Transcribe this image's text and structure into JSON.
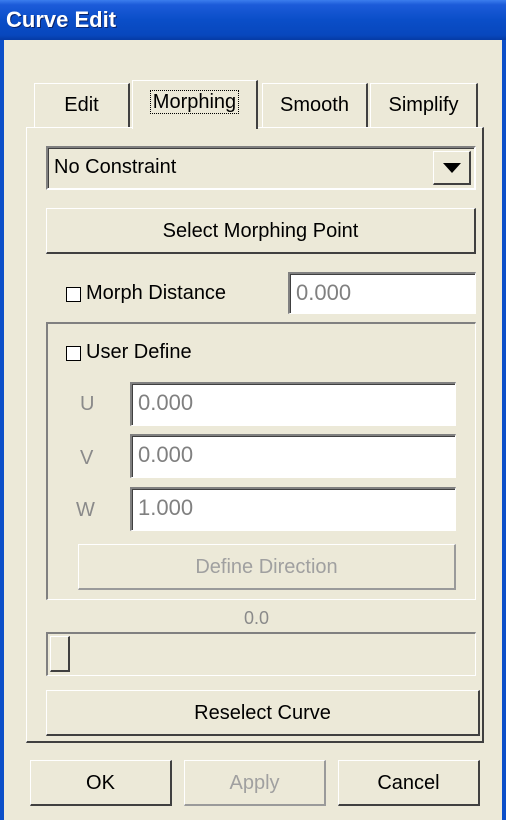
{
  "window": {
    "title": "Curve Edit"
  },
  "tabs": [
    {
      "label": "Edit",
      "active": false
    },
    {
      "label": "Morphing",
      "active": true
    },
    {
      "label": "Smooth",
      "active": false
    },
    {
      "label": "Simplify",
      "active": false
    }
  ],
  "constraint": {
    "selected": "No Constraint"
  },
  "select_point_label": "Select Morphing Point",
  "morph_distance": {
    "label": "Morph Distance",
    "checked": false,
    "value": "0.000"
  },
  "user_define": {
    "label": "User Define",
    "checked": false,
    "u": {
      "label": "U",
      "value": "0.000"
    },
    "v": {
      "label": "V",
      "value": "0.000"
    },
    "w": {
      "label": "W",
      "value": "1.000"
    },
    "define_direction_label": "Define Direction"
  },
  "slider": {
    "value_text": "0.0",
    "value": 0.0
  },
  "reselect_label": "Reselect Curve",
  "footer": {
    "ok_label": "OK",
    "apply_label": "Apply",
    "cancel_label": "Cancel"
  },
  "colors": {
    "titlebar": "#0a4ec8",
    "face": "#ece9d8",
    "disabled_text": "#a0a0a0"
  }
}
